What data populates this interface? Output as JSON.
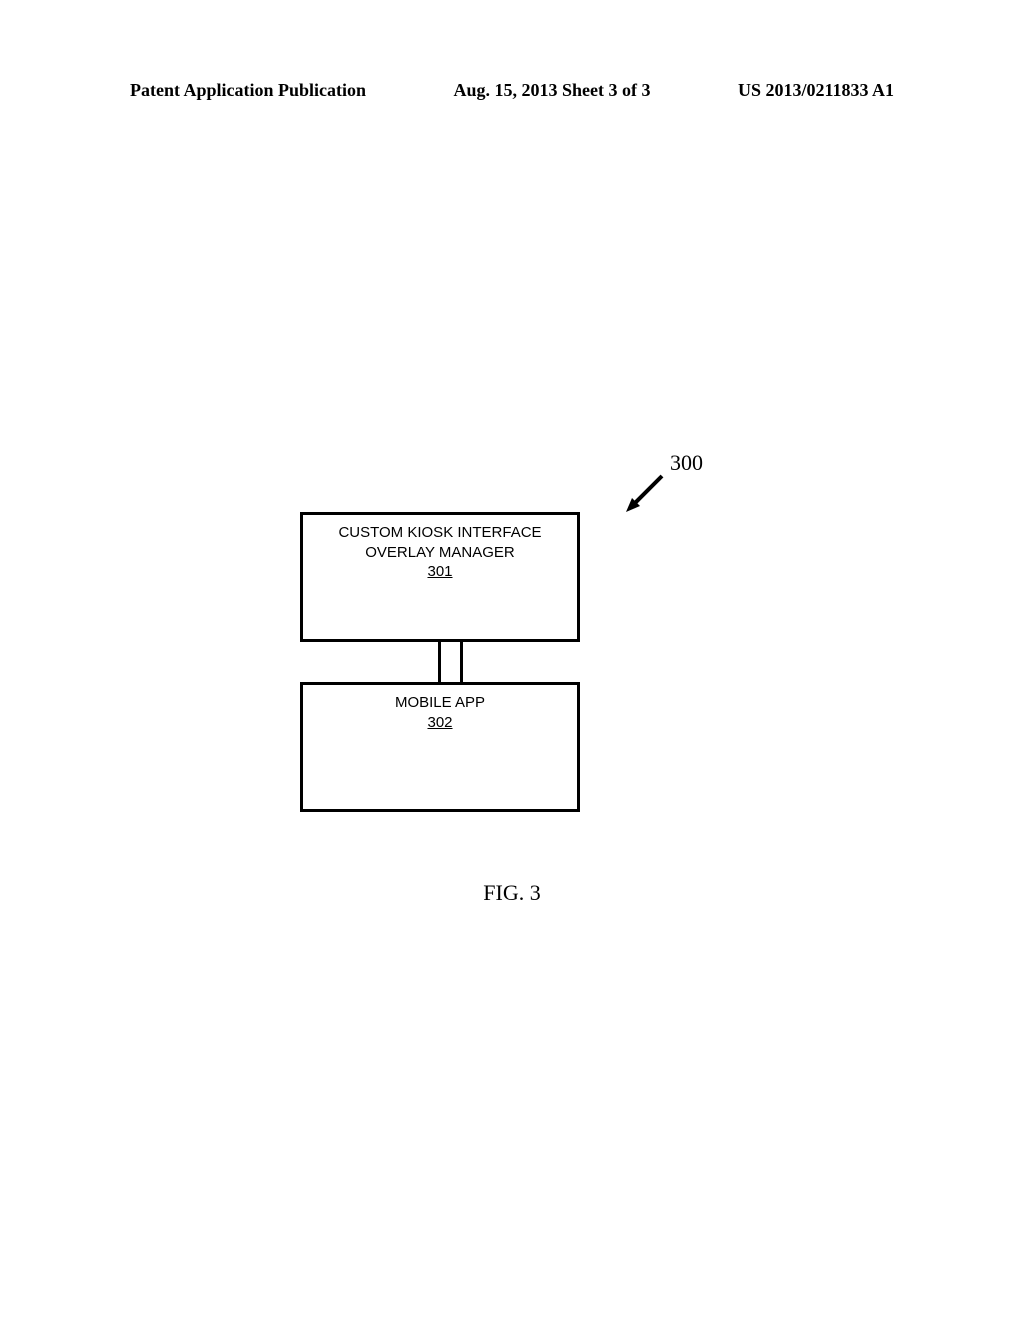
{
  "header": {
    "left": "Patent Application Publication",
    "center": "Aug. 15, 2013  Sheet 3 of 3",
    "right": "US 2013/0211833 A1"
  },
  "diagram": {
    "ref_main": "300",
    "box_top": {
      "line1": "CUSTOM KIOSK INTERFACE",
      "line2": "OVERLAY MANAGER",
      "ref": "301"
    },
    "box_bottom": {
      "line1": "MOBILE APP",
      "ref": "302"
    }
  },
  "figure_caption": "FIG. 3"
}
